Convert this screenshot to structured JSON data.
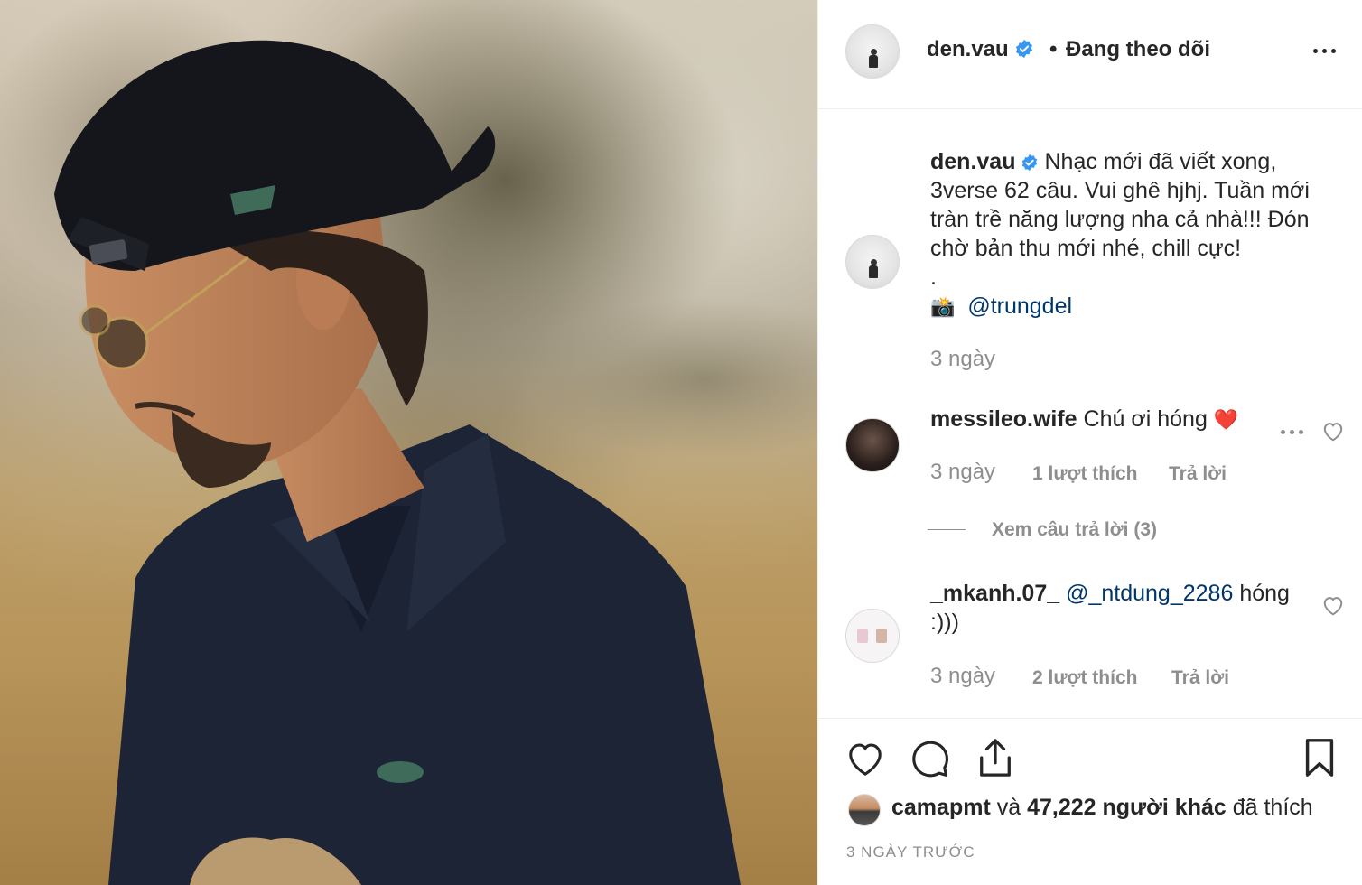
{
  "colors": {
    "accent": "#0095f6",
    "verified": "#3897f0",
    "heart": "#ed4956",
    "text": "#262626",
    "muted": "#8e8e8e",
    "link": "#00376b"
  },
  "header": {
    "username": "den.vau",
    "separator": "•",
    "follow_status": "Đang theo dõi",
    "more_icon": "more-horizontal-icon"
  },
  "caption": {
    "username": "den.vau",
    "text": "Nhạc mới đã viết xong, 3verse 62 câu. Vui ghê hjhj. Tuần mới tràn trề năng lượng nha cả nhà!!! Đón chờ bản thu mới nhé, chill cực!",
    "dot": ".",
    "camera_emoji": "📸",
    "mention": "@trungdel",
    "time": "3 ngày"
  },
  "comments": [
    {
      "username": "messileo.wife",
      "text": "Chú ơi hóng",
      "emoji": "❤️",
      "time": "3 ngày",
      "likes": "1 lượt thích",
      "reply": "Trả lời",
      "view_replies": "Xem câu trả lời (3)"
    },
    {
      "username": "_mkanh.07_",
      "mention": "@_ntdung_2286",
      "text": "hóng :)))",
      "time": "3 ngày",
      "likes": "2 lượt thích",
      "reply": "Trả lời"
    }
  ],
  "actions": {
    "like_icon": "heart-icon",
    "comment_icon": "comment-icon",
    "share_icon": "share-icon",
    "save_icon": "bookmark-icon"
  },
  "likes": {
    "user": "camapmt",
    "connector": "và",
    "count": "47,222 người khác",
    "suffix": "đã thích"
  },
  "timestamp": "3 NGÀY TRƯỚC"
}
